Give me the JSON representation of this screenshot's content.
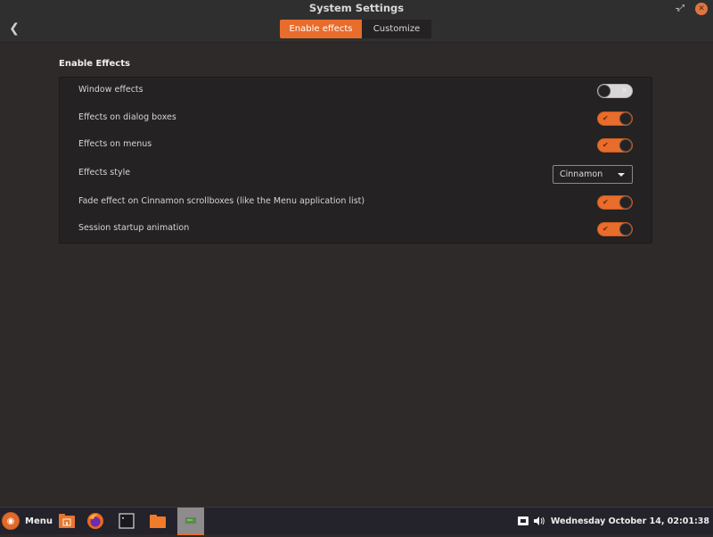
{
  "window": {
    "title": "System Settings",
    "back_icon": "chevron-left-icon",
    "controls": {
      "minimize": "–",
      "restore": "⤢",
      "close": "✕"
    }
  },
  "tabs": [
    {
      "label": "Enable effects",
      "active": true
    },
    {
      "label": "Customize",
      "active": false
    }
  ],
  "section": {
    "title": "Enable Effects",
    "rows": [
      {
        "label": "Window effects",
        "type": "switch",
        "value": false
      },
      {
        "label": "Effects on dialog boxes",
        "type": "switch",
        "value": true
      },
      {
        "label": "Effects on menus",
        "type": "switch",
        "value": true
      },
      {
        "label": "Effects style",
        "type": "dropdown",
        "value": "Cinnamon"
      },
      {
        "label": "Fade effect on Cinnamon scrollboxes (like the Menu application list)",
        "type": "switch",
        "value": true
      },
      {
        "label": "Session startup animation",
        "type": "switch",
        "value": true
      }
    ]
  },
  "switch_glyphs": {
    "on": "✔",
    "off": "✕"
  },
  "taskbar": {
    "menu_label": "Menu",
    "menu_logo": "ubuntu-logo-icon",
    "launchers": [
      "folder-home-icon",
      "firefox-icon",
      "terminal-icon",
      "files-icon",
      "settings-window-icon"
    ],
    "tray": {
      "network_icon": "network-wired-icon",
      "volume_icon": "volume-icon",
      "clock": "Wednesday October 14, 02:01:38"
    }
  },
  "colors": {
    "accent": "#e86c2c",
    "background": "#2d2a29",
    "panel": "#242222",
    "headerbar": "#302f2f"
  }
}
